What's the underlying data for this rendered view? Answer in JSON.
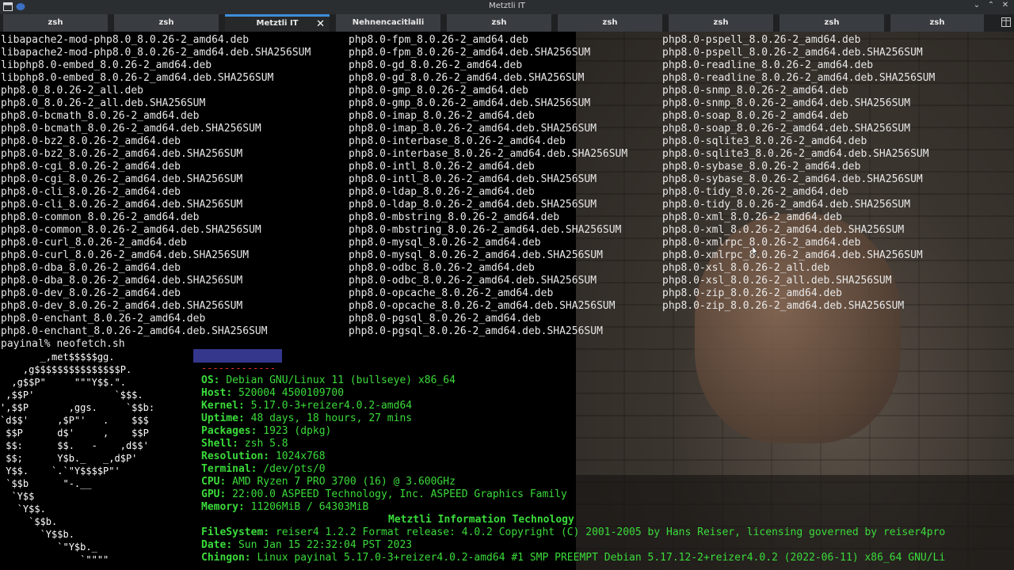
{
  "window": {
    "title": "Metztli IT",
    "icons": {
      "app": "terminal-icon",
      "menu": "app-menu-icon"
    },
    "controls": {
      "minimize": "⌄",
      "maximize": "⌃",
      "close": "✕"
    }
  },
  "tabs": [
    {
      "label": "zsh"
    },
    {
      "label": "zsh"
    },
    {
      "label": "Metztli IT",
      "active": true
    },
    {
      "label": "Nehnencacitlalli"
    },
    {
      "label": "zsh"
    },
    {
      "label": "zsh"
    },
    {
      "label": "zsh"
    },
    {
      "label": "zsh"
    },
    {
      "label": "zsh"
    }
  ],
  "files": {
    "col1": [
      "libapache2-mod-php8.0_8.0.26-2_amd64.deb",
      "libapache2-mod-php8.0_8.0.26-2_amd64.deb.SHA256SUM",
      "libphp8.0-embed_8.0.26-2_amd64.deb",
      "libphp8.0-embed_8.0.26-2_amd64.deb.SHA256SUM",
      "php8.0_8.0.26-2_all.deb",
      "php8.0_8.0.26-2_all.deb.SHA256SUM",
      "php8.0-bcmath_8.0.26-2_amd64.deb",
      "php8.0-bcmath_8.0.26-2_amd64.deb.SHA256SUM",
      "php8.0-bz2_8.0.26-2_amd64.deb",
      "php8.0-bz2_8.0.26-2_amd64.deb.SHA256SUM",
      "php8.0-cgi_8.0.26-2_amd64.deb",
      "php8.0-cgi_8.0.26-2_amd64.deb.SHA256SUM",
      "php8.0-cli_8.0.26-2_amd64.deb",
      "php8.0-cli_8.0.26-2_amd64.deb.SHA256SUM",
      "php8.0-common_8.0.26-2_amd64.deb",
      "php8.0-common_8.0.26-2_amd64.deb.SHA256SUM",
      "php8.0-curl_8.0.26-2_amd64.deb",
      "php8.0-curl_8.0.26-2_amd64.deb.SHA256SUM",
      "php8.0-dba_8.0.26-2_amd64.deb",
      "php8.0-dba_8.0.26-2_amd64.deb.SHA256SUM",
      "php8.0-dev_8.0.26-2_amd64.deb",
      "php8.0-dev_8.0.26-2_amd64.deb.SHA256SUM",
      "php8.0-enchant_8.0.26-2_amd64.deb",
      "php8.0-enchant_8.0.26-2_amd64.deb.SHA256SUM"
    ],
    "col2": [
      "php8.0-fpm_8.0.26-2_amd64.deb",
      "php8.0-fpm_8.0.26-2_amd64.deb.SHA256SUM",
      "php8.0-gd_8.0.26-2_amd64.deb",
      "php8.0-gd_8.0.26-2_amd64.deb.SHA256SUM",
      "php8.0-gmp_8.0.26-2_amd64.deb",
      "php8.0-gmp_8.0.26-2_amd64.deb.SHA256SUM",
      "php8.0-imap_8.0.26-2_amd64.deb",
      "php8.0-imap_8.0.26-2_amd64.deb.SHA256SUM",
      "php8.0-interbase_8.0.26-2_amd64.deb",
      "php8.0-interbase_8.0.26-2_amd64.deb.SHA256SUM",
      "php8.0-intl_8.0.26-2_amd64.deb",
      "php8.0-intl_8.0.26-2_amd64.deb.SHA256SUM",
      "php8.0-ldap_8.0.26-2_amd64.deb",
      "php8.0-ldap_8.0.26-2_amd64.deb.SHA256SUM",
      "php8.0-mbstring_8.0.26-2_amd64.deb",
      "php8.0-mbstring_8.0.26-2_amd64.deb.SHA256SUM",
      "php8.0-mysql_8.0.26-2_amd64.deb",
      "php8.0-mysql_8.0.26-2_amd64.deb.SHA256SUM",
      "php8.0-odbc_8.0.26-2_amd64.deb",
      "php8.0-odbc_8.0.26-2_amd64.deb.SHA256SUM",
      "php8.0-opcache_8.0.26-2_amd64.deb",
      "php8.0-opcache_8.0.26-2_amd64.deb.SHA256SUM",
      "php8.0-pgsql_8.0.26-2_amd64.deb",
      "php8.0-pgsql_8.0.26-2_amd64.deb.SHA256SUM"
    ],
    "col3": [
      "php8.0-pspell_8.0.26-2_amd64.deb",
      "php8.0-pspell_8.0.26-2_amd64.deb.SHA256SUM",
      "php8.0-readline_8.0.26-2_amd64.deb",
      "php8.0-readline_8.0.26-2_amd64.deb.SHA256SUM",
      "php8.0-snmp_8.0.26-2_amd64.deb",
      "php8.0-snmp_8.0.26-2_amd64.deb.SHA256SUM",
      "php8.0-soap_8.0.26-2_amd64.deb",
      "php8.0-soap_8.0.26-2_amd64.deb.SHA256SUM",
      "php8.0-sqlite3_8.0.26-2_amd64.deb",
      "php8.0-sqlite3_8.0.26-2_amd64.deb.SHA256SUM",
      "php8.0-sybase_8.0.26-2_amd64.deb",
      "php8.0-sybase_8.0.26-2_amd64.deb.SHA256SUM",
      "php8.0-tidy_8.0.26-2_amd64.deb",
      "php8.0-tidy_8.0.26-2_amd64.deb.SHA256SUM",
      "php8.0-xml_8.0.26-2_amd64.deb",
      "php8.0-xml_8.0.26-2_amd64.deb.SHA256SUM",
      "php8.0-xmlrpc_8.0.26-2_amd64.deb",
      "php8.0-xmlrpc_8.0.26-2_amd64.deb.SHA256SUM",
      "php8.0-xsl_8.0.26-2_all.deb",
      "php8.0-xsl_8.0.26-2_all.deb.SHA256SUM",
      "php8.0-zip_8.0.26-2_amd64.deb",
      "php8.0-zip_8.0.26-2_amd64.deb.SHA256SUM"
    ]
  },
  "prompt": {
    "text": "payinal% neofetch.sh"
  },
  "logo": [
    "       _,met$$$$$gg.",
    "    ,g$$$$$$$$$$$$$$$P.",
    "  ,g$$P\"     \"\"\"Y$$.\".",
    " ,$$P'              `$$$.",
    "',$$P       ,ggs.     `$$b:",
    "`d$$'     ,$P\"'   .    $$$",
    " $$P      d$'     ,    $$P",
    " $$:      $$.   -    ,d$$'",
    " $$;      Y$b._   _,d$P'",
    " Y$$.    `.`\"Y$$$$P\"'",
    " `$$b      \"-.__",
    "  `Y$$",
    "   `Y$$.",
    "     `$$b.",
    "       `Y$$b.",
    "          `\"Y$b._",
    "              `\"\"\"\""
  ],
  "separator": "-------------",
  "sysinfo": [
    {
      "key": "OS",
      "value": "Debian GNU/Linux 11 (bullseye) x86_64"
    },
    {
      "key": "Host",
      "value": "520004 4500109700"
    },
    {
      "key": "Kernel",
      "value": "5.17.0-3+reizer4.0.2-amd64"
    },
    {
      "key": "Uptime",
      "value": "48 days, 18 hours, 27 mins"
    },
    {
      "key": "Packages",
      "value": "1923 (dpkg)"
    },
    {
      "key": "Shell",
      "value": "zsh 5.8"
    },
    {
      "key": "Resolution",
      "value": "1024x768"
    },
    {
      "key": "Terminal",
      "value": "/dev/pts/0"
    },
    {
      "key": "CPU",
      "value": "AMD Ryzen 7 PRO 3700 (16) @ 3.600GHz"
    },
    {
      "key": "GPU",
      "value": "22:00.0 ASPEED Technology, Inc. ASPEED Graphics Family"
    },
    {
      "key": "Memory",
      "value": "11206MiB / 64303MiB"
    }
  ],
  "company": "Metztli Information Technology",
  "sysinfo2": [
    {
      "key": "FileSystem",
      "value": "reiser4 1.2.2 Format release: 4.0.2 Copyright (C) 2001-2005 by Hans Reiser, licensing governed by reiser4pro"
    },
    {
      "key": "Date",
      "value": "Sun Jan 15 22:32:04 PST 2023"
    },
    {
      "key": "Chingon",
      "value": "Linux payinal 5.17.0-3+reizer4.0.2-amd64 #1 SMP PREEMPT Debian 5.17.12-2+reizer4.0.2 (2022-06-11) x86_64 GNU/Li"
    }
  ],
  "colors": {
    "accent": "#3d8fd9",
    "info_green": "#3bdb3b",
    "separator_red": "#e83030",
    "colorbar": "#34378c"
  }
}
